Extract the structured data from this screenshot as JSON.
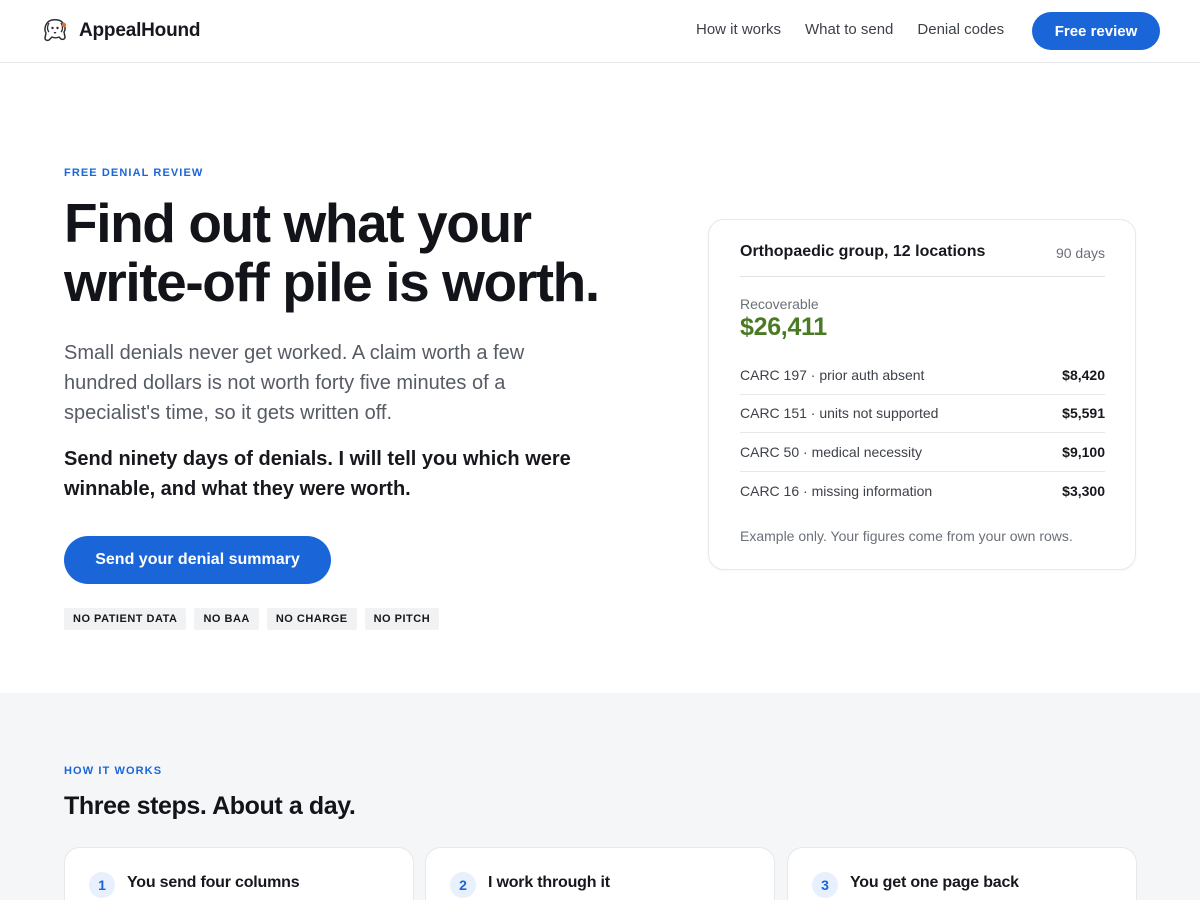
{
  "nav": {
    "brand": "AppealHound",
    "links": [
      "How it works",
      "What to send",
      "Denial codes"
    ],
    "cta": "Free review"
  },
  "hero": {
    "eyebrow": "FREE DENIAL REVIEW",
    "title": "Find out what your write-off pile is worth.",
    "lead": "Small denials never get worked. A claim worth a few hundred dollars is not worth forty five minutes of a specialist's time, so it gets written off.",
    "strong": "Send ninety days of denials. I will tell you which were winnable, and what they were worth.",
    "cta": "Send your denial summary",
    "tags": [
      "NO PATIENT DATA",
      "NO BAA",
      "NO CHARGE",
      "NO PITCH"
    ]
  },
  "example": {
    "title": "Orthopaedic group, 12 locations",
    "period": "90 days",
    "recoverable_label": "Recoverable",
    "recoverable_value": "$26,411",
    "rows": [
      {
        "code": "CARC 197 · prior auth absent",
        "amount": "$8,420"
      },
      {
        "code": "CARC 151 · units not supported",
        "amount": "$5,591"
      },
      {
        "code": "CARC 50 · medical necessity",
        "amount": "$9,100"
      },
      {
        "code": "CARC 16 · missing information",
        "amount": "$3,300"
      }
    ],
    "note": "Example only. Your figures come from your own rows."
  },
  "how": {
    "eyebrow": "HOW IT WORKS",
    "title": "Three steps. About a day.",
    "steps": [
      {
        "num": "1",
        "title": "You send four columns"
      },
      {
        "num": "2",
        "title": "I work through it"
      },
      {
        "num": "3",
        "title": "You get one page back"
      }
    ]
  },
  "colors": {
    "accent": "#1a66d9",
    "recoverable": "#4a7a24",
    "section_bg": "#f5f6f8"
  }
}
